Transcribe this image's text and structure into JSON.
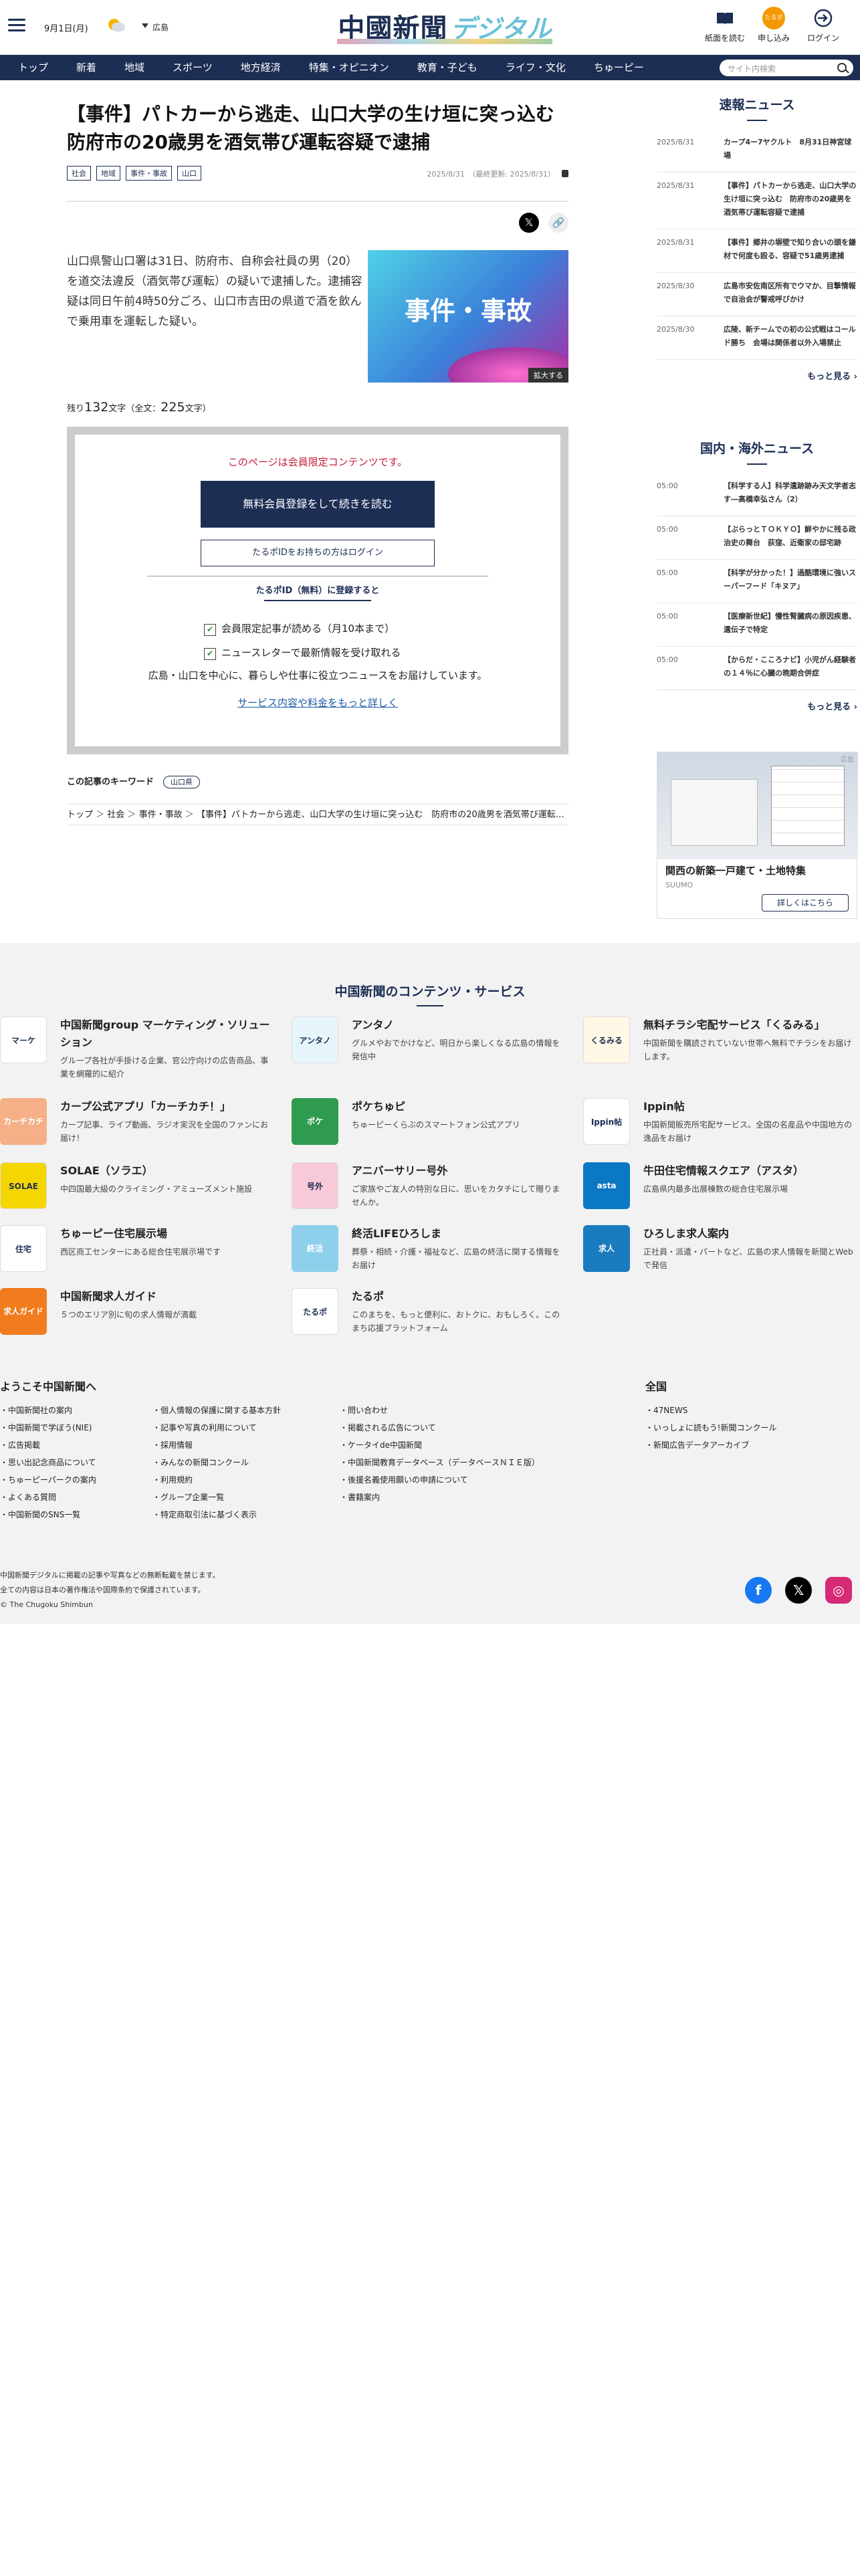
{
  "header": {
    "date": "9月1日(月)",
    "region": "広島",
    "logo_main": "中國新聞",
    "logo_sub": "デジタル",
    "paper_label": "紙面を読む",
    "signup_label": "申し込み",
    "login_label": "ログイン",
    "weather_icon": "sun-cloud-icon"
  },
  "nav": {
    "items": [
      "トップ",
      "新着",
      "地域",
      "スポーツ",
      "地方経済",
      "特集・オピニオン",
      "教育・子ども",
      "ライフ・文化",
      "ちゅーピー"
    ],
    "search_placeholder": "サイト内検索"
  },
  "article": {
    "title": "【事件】パトカーから逃走、山口大学の生け垣に突っ込む 防府市の20歳男を酒気帯び運転容疑で逮捕",
    "tags": [
      "社会",
      "地域",
      "事件・事故",
      "山口"
    ],
    "date": "2025/8/31",
    "updated": "（最終更新: 2025/8/31）",
    "lead": "山口県警山口署は31日、防府市、自称会社員の男（20）を道交法違反（酒気帯び運転）の疑いで逮捕した。逮捕容疑は同日午前4時50分ごろ、山口市吉田の県道で酒を飲んで乗用車を運転した疑い。",
    "photo_text": "事件・事故",
    "zoom_label": "拡大する",
    "remaining_prefix": "残り",
    "remaining_count": "132",
    "remaining_suffix": "文字（全文：",
    "total_count": "225",
    "total_suffix": "文字）",
    "keywords_label": "この記事のキーワード",
    "keyword": "山口県",
    "breadcrumb": [
      "トップ",
      "社会",
      "事件・事故",
      "【事件】パトカーから逃走、山口大学の生け垣に突っ込む　防府市の20歳男を酒気帯び運転容疑で逮捕"
    ]
  },
  "paywall": {
    "message": "このページは会員限定コンテンツです。",
    "register_button": "無料会員登録をして続きを読む",
    "login_button": "たるポIDをお持ちの方はログイン",
    "heading": "たるポID（無料）に登録すると",
    "benefits": [
      "会員限定記事が読める（月10本まで）",
      "ニュースレターで最新情報を受け取れる"
    ],
    "description": "広島・山口を中心に、暮らしや仕事に役立つニュースをお届けしています。",
    "more_link": "サービス内容や料金をもっと詳しく"
  },
  "sidebar": {
    "breaking_title": "速報ニュース",
    "breaking": [
      {
        "date": "2025/8/31",
        "title": "カープ4ー7ヤクルト　8月31日神宮球場"
      },
      {
        "date": "2025/8/31",
        "title": "【事件】パトカーから逃走、山口大学の生け垣に突っ込む　防府市の20歳男を酒気帯び運転容疑で逮捕"
      },
      {
        "date": "2025/8/31",
        "title": "【事件】郷井の塀壁で知り合いの頭を鎌材で何度も殴る、容疑で51歳男逮捕"
      },
      {
        "date": "2025/8/30",
        "title": "広島市安佐南区所有でウマか、目撃情報で自治会が警戒呼びかけ"
      },
      {
        "date": "2025/8/30",
        "title": "広陵、新チームでの初の公式戦はコールド勝ち　会場は関係者以外入場禁止"
      }
    ],
    "more_label": "もっと見る",
    "world_title": "国内・海外ニュース",
    "world": [
      {
        "date": "05:00",
        "title": "【科学する人】科学遺跡跡み天文学者志す―高橋幸弘さん（2）"
      },
      {
        "date": "05:00",
        "title": "【ぶらっとＴＯＫＹＯ】鮮やかに残る政治史の舞台　荻窪、近衛家の邸宅跡"
      },
      {
        "date": "05:00",
        "title": "【科学が分かった！】過酷環境に強いスーパーフード「キヌア」"
      },
      {
        "date": "05:00",
        "title": "【医療新世紀】慢性腎臓病の原因疾患、遺伝子で特定"
      },
      {
        "date": "05:00",
        "title": "【からだ・こころナビ】小児がん経験者の１４％に心臓の晩期合併症"
      }
    ],
    "ad_mark": "広告",
    "ad_title": "関西の新築一戸建て・土地特集",
    "ad_source": "SUUMO",
    "ad_button": "詳しくはこちら"
  },
  "footer": {
    "services_title": "中国新聞のコンテンツ・サービス",
    "services": [
      {
        "name": "中国新聞group マーケティング・ソリューション",
        "desc": "グループ各社が手掛ける企業、官公庁向けの広告商品、事業を網羅的に紹介",
        "icon": "マーケ",
        "color": "#ffffff"
      },
      {
        "name": "アンタノ",
        "desc": "グルメやおでかけなど、明日から楽しくなる広島の情報を発信中",
        "icon": "アンタノ",
        "color": "#e6f5fa"
      },
      {
        "name": "無料チラシ宅配サービス「くるみる」",
        "desc": "中国新聞を購読されていない世帯へ無料でチラシをお届けします。",
        "icon": "くるみる",
        "color": "#fff8e6"
      },
      {
        "name": "カープ公式アプリ「カーチカチ！」",
        "desc": "カープ記事、ライブ動画、ラジオ実況を全国のファンにお届け！",
        "icon": "カーチカチ",
        "color": "#f5b087"
      },
      {
        "name": "ポケちゅピ",
        "desc": "ちゅーピーくらぶのスマートフォン公式アプリ",
        "icon": "ポケ",
        "color": "#2e9b4e"
      },
      {
        "name": "Ippin帖",
        "desc": "中国新聞販売所宅配サービス。全国の名産品や中国地方の逸品をお届け",
        "icon": "Ippin帖",
        "color": "#ffffff"
      },
      {
        "name": "SOLAE（ソラエ）",
        "desc": "中四国最大級のクライミング・アミューズメント施設",
        "icon": "SOLAE",
        "color": "#f4d600"
      },
      {
        "name": "アニバーサリー号外",
        "desc": "ご家族やご友人の特別な日に、思いをカタチにして贈りませんか。",
        "icon": "号外",
        "color": "#f8c9d9"
      },
      {
        "name": "牛田住宅情報スクエア（アスタ）",
        "desc": "広島県内最多出展棟数の総合住宅展示場",
        "icon": "asta",
        "color": "#0a78c2"
      },
      {
        "name": "ちゅーピー住宅展示場",
        "desc": "西区商工センターにある総合住宅展示場です",
        "icon": "住宅",
        "color": "#ffffff"
      },
      {
        "name": "終活LIFEひろしま",
        "desc": "葬祭・相続・介護・福祉など、広島の終活に関する情報をお届け",
        "icon": "終活",
        "color": "#8ed0ec"
      },
      {
        "name": "ひろしま求人案内",
        "desc": "正社員・派遣・パートなど、広島の求人情報を新聞とWebで発信",
        "icon": "求人",
        "color": "#1b7bbf"
      },
      {
        "name": "中国新聞求人ガイド",
        "desc": "５つのエリア別に旬の求人情報が満載",
        "icon": "求人ガイド",
        "color": "#f07c1e"
      },
      {
        "name": "たるポ",
        "desc": "このまちを、もっと便利に、おトクに、おもしろく。このまち応援プラットフォーム",
        "icon": "たるポ",
        "color": "#ffffff"
      }
    ],
    "welcome_title": "ようこそ中国新聞へ",
    "national_title": "全国",
    "col1": [
      "中国新聞社の案内",
      "中国新聞で学ぼう(NIE)",
      "広告掲載",
      "思い出記念商品について",
      "ちゅーピーパークの案内",
      "よくある質問",
      "中国新聞のSNS一覧"
    ],
    "col2": [
      "個人情報の保護に関する基本方針",
      "記事や写真の利用について",
      "採用情報",
      "みんなの新聞コンクール",
      "利用規約",
      "グループ企業一覧",
      "特定商取引法に基づく表示"
    ],
    "col3": [
      "問い合わせ",
      "掲載される広告について",
      "ケータイde中国新聞",
      "中国新聞教育データベース（データベースＮＩＥ版）",
      "後援名義使用願いの申請について",
      "書籍案内"
    ],
    "col4": [
      "47NEWS",
      "いっしょに読もう!新聞コンクール",
      "新聞広告データアーカイブ"
    ],
    "copy1": "中国新聞デジタルに掲載の記事や写真などの無断転載を禁じます。",
    "copy2": "全ての内容は日本の著作権法や国際条約で保護されています。",
    "copy3": "© The Chugoku Shimbun",
    "sns_colors": [
      "#1877f2",
      "#000000",
      "#d62976"
    ]
  }
}
